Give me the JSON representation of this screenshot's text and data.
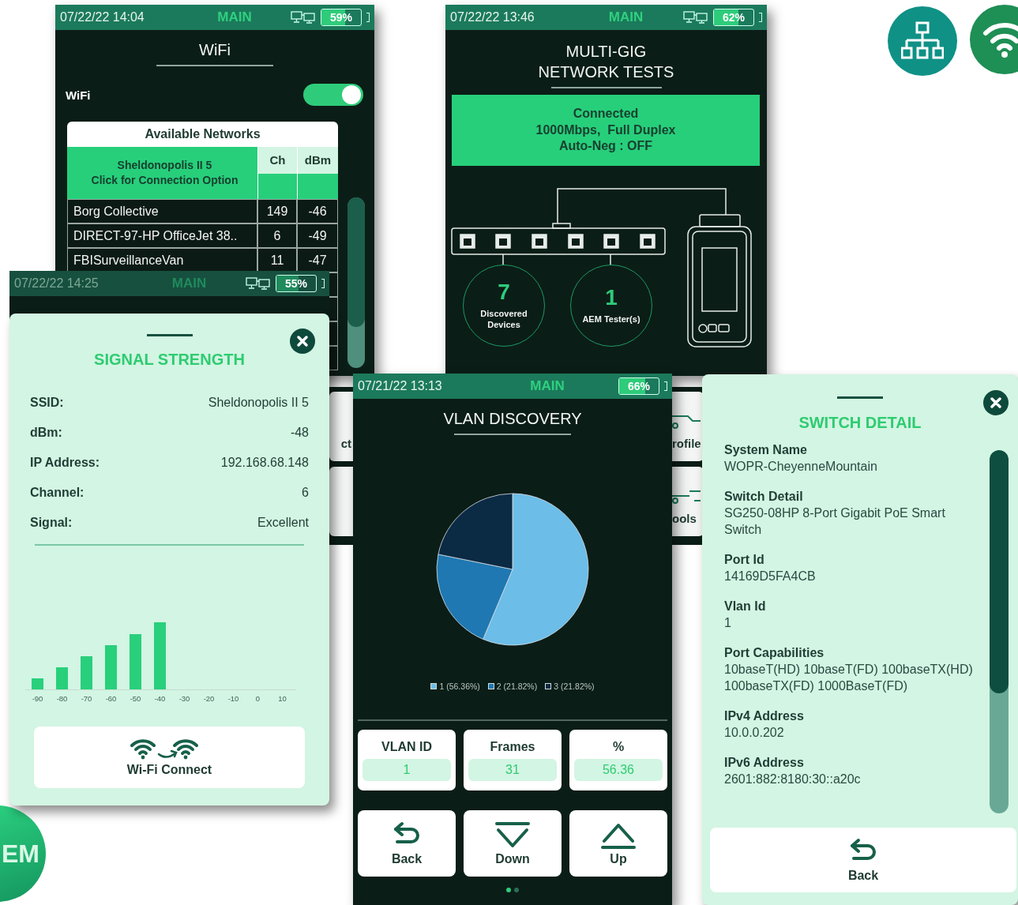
{
  "wifi_screen": {
    "status_bar": {
      "datetime": "07/22/22 14:04",
      "mode": "MAIN",
      "link_icon": true,
      "battery": {
        "text": "59%",
        "level": 0.59
      }
    },
    "title": "WiFi",
    "toggle": {
      "label": "WiFi",
      "on": true
    },
    "networks": {
      "title": "Available Networks",
      "columns": [
        "Ch",
        "dBm"
      ],
      "connected": {
        "name": "Sheldonopolis II 5",
        "hint": "Click for Connection Option"
      },
      "rows": [
        {
          "name": "Borg Collective",
          "ch": "149",
          "dbm": "-46"
        },
        {
          "name": "DIRECT-97-HP OfficeJet 38..",
          "ch": "6",
          "dbm": "-49"
        },
        {
          "name": "FBISurveillanceVan",
          "ch": "11",
          "dbm": "-47"
        }
      ]
    }
  },
  "network_test_screen": {
    "status_bar": {
      "datetime": "07/22/22 13:46",
      "mode": "MAIN",
      "link_icon": true,
      "battery": {
        "text": "62%",
        "level": 0.62
      }
    },
    "title": [
      "MULTI-GIG",
      "NETWORK TESTS"
    ],
    "status_lines": [
      "Connected",
      "1000Mbps,  Full Duplex",
      "Auto-Neg : OFF"
    ],
    "counters": [
      {
        "value": "7",
        "label": "Discovered Devices"
      },
      {
        "value": "1",
        "label": "AEM Tester(s)"
      }
    ]
  },
  "wifi_tools_screen": {
    "status_bar": {
      "datetime": "07/22/22 14:25",
      "mode": "MAIN",
      "link_icon": true,
      "battery": {
        "text": "55%",
        "level": 0.55
      }
    }
  },
  "menu_screen": {
    "left_labels": [
      "ct"
    ],
    "right_labels": [
      "rofile",
      "ools"
    ]
  },
  "signal_strength": {
    "title": "SIGNAL STRENGTH",
    "fields": [
      {
        "label": "SSID:",
        "value": "Sheldonopolis II 5"
      },
      {
        "label": "dBm:",
        "value": "-48"
      },
      {
        "label": "IP Address:",
        "value": "192.168.68.148"
      },
      {
        "label": "Channel:",
        "value": "6"
      },
      {
        "label": "Signal:",
        "value": "Excellent"
      }
    ],
    "axis_labels": [
      "-90",
      "-80",
      "-70",
      "-60",
      "-50",
      "-40",
      "-30",
      "-20",
      "-10",
      "0",
      "10"
    ],
    "button": "Wi-Fi Connect"
  },
  "vlan_screen": {
    "status_bar": {
      "datetime": "07/21/22 13:13",
      "mode": "MAIN",
      "link_icon": false,
      "battery": {
        "text": "66%",
        "level": 0.66
      }
    },
    "title": "VLAN DISCOVERY",
    "chart_data": {
      "type": "pie",
      "categories": [
        "1 (56.36%)",
        "2 (21.82%)",
        "3 (21.82%)"
      ],
      "values": [
        56.36,
        21.82,
        21.82
      ],
      "legend": "bottom"
    },
    "stats": [
      {
        "label": "VLAN ID",
        "value": "1"
      },
      {
        "label": "Frames",
        "value": "31"
      },
      {
        "label": "%",
        "value": "56.36"
      }
    ],
    "buttons": [
      {
        "label": "Back",
        "kind": "back"
      },
      {
        "label": "Down",
        "kind": "down"
      },
      {
        "label": "Up",
        "kind": "up"
      }
    ],
    "pages": [
      {
        "selected": true
      },
      {
        "selected": false
      }
    ]
  },
  "switch_detail": {
    "title": "SWITCH DETAIL",
    "fields": [
      {
        "label": "System Name",
        "value": "WOPR-CheyenneMountain"
      },
      {
        "label": "Switch Detail",
        "value": "SG250-08HP 8-Port Gigabit PoE Smart Switch"
      },
      {
        "label": "Port Id",
        "value": "14169D5FA4CB"
      },
      {
        "label": "Vlan Id",
        "value": "1"
      },
      {
        "label": "Port Capabilities",
        "value": "10baseT(HD) 10baseT(FD) 100baseTX(HD) 100baseTX(FD) 1000BaseT(FD)"
      },
      {
        "label": "IPv4 Address",
        "value": "10.0.0.202"
      },
      {
        "label": "IPv6 Address",
        "value": "2601:882:8180:30::a20c"
      }
    ],
    "button": "Back"
  },
  "logo_badge": {
    "text": "EM"
  }
}
